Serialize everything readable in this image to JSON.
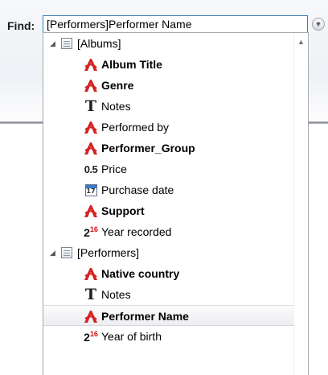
{
  "find": {
    "label": "Find:",
    "value": "[Performers]Performer Name"
  },
  "tree": {
    "groups": [
      {
        "label": "[Albums]",
        "fields": [
          {
            "label": "Album Title",
            "type": "text",
            "bold": true
          },
          {
            "label": "Genre",
            "type": "text",
            "bold": true
          },
          {
            "label": "Notes",
            "type": "memo",
            "bold": false
          },
          {
            "label": "Performed by",
            "type": "text",
            "bold": false
          },
          {
            "label": "Performer_Group",
            "type": "text",
            "bold": true
          },
          {
            "label": "Price",
            "type": "real",
            "bold": false
          },
          {
            "label": "Purchase date",
            "type": "date",
            "bold": false
          },
          {
            "label": "Support",
            "type": "text",
            "bold": true
          },
          {
            "label": "Year recorded",
            "type": "integer",
            "bold": false
          }
        ]
      },
      {
        "label": "[Performers]",
        "fields": [
          {
            "label": "Native country",
            "type": "text",
            "bold": true
          },
          {
            "label": "Notes",
            "type": "memo",
            "bold": false
          },
          {
            "label": "Performer Name",
            "type": "text",
            "bold": true,
            "selected": true
          },
          {
            "label": "Year of birth",
            "type": "integer",
            "bold": false
          }
        ]
      }
    ]
  },
  "icons": {
    "text_field": "text-field-icon",
    "memo_field": "memo-field-icon",
    "real_field": "real-field-icon",
    "real_glyph": "0.5",
    "date_field": "date-field-icon",
    "date_glyph": "17",
    "integer_field": "integer-field-icon",
    "integer_base": "2",
    "integer_exp": "16",
    "text_accent_color": "#d42323"
  }
}
